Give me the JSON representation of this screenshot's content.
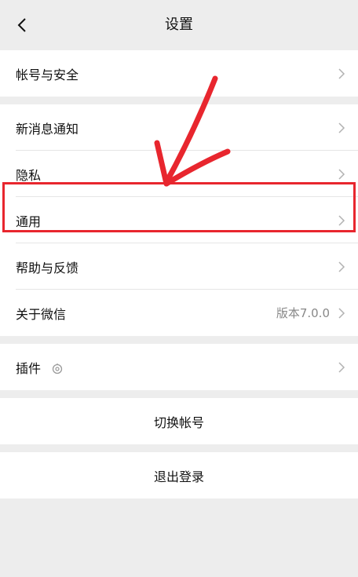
{
  "header": {
    "title": "设置"
  },
  "sections": [
    {
      "items": [
        {
          "label": "帐号与安全"
        }
      ]
    },
    {
      "items": [
        {
          "label": "新消息通知"
        },
        {
          "label": "隐私"
        },
        {
          "label": "通用"
        },
        {
          "label": "帮助与反馈"
        },
        {
          "label": "关于微信",
          "value": "版本7.0.0"
        }
      ]
    },
    {
      "items": [
        {
          "label": "插件",
          "icon": "plugin-icon"
        }
      ]
    }
  ],
  "actions": {
    "switch_account": "切换帐号",
    "logout": "退出登录"
  },
  "colors": {
    "highlight": "#e8262e",
    "background": "#ededed"
  }
}
